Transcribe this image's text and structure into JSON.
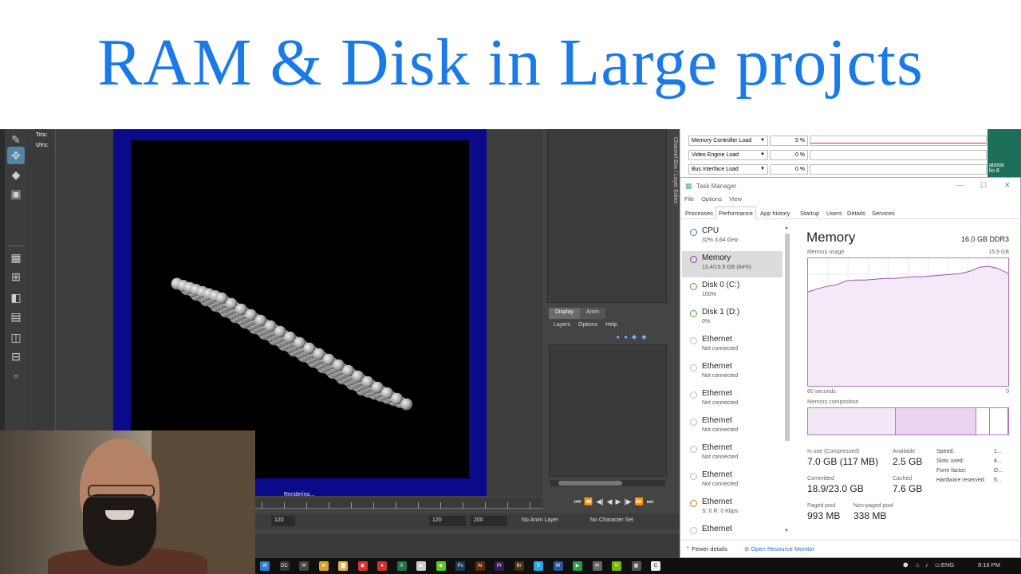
{
  "banner": {
    "title": "RAM & Disk in Large projcts"
  },
  "maya": {
    "hud": {
      "tris": "Tris:",
      "uvs": "UVs:"
    },
    "render_status": "Rendering...",
    "side_panel_label": "Channel Box / Layer Editor",
    "layer_tabs": [
      "Display",
      "Anim"
    ],
    "layer_menu": [
      "Layers",
      "Options",
      "Help"
    ],
    "range": {
      "end1": "120",
      "end2": "120",
      "end3": "200",
      "anim_layer": "No Anim Layer",
      "char_set": "No Character Set"
    }
  },
  "perfmon": {
    "rows": [
      {
        "name": "Memory Controller Load",
        "value": "5 %"
      },
      {
        "name": "Video Engine Load",
        "value": "0 %"
      },
      {
        "name": "Bus Interface Load",
        "value": "0 %"
      }
    ],
    "desktop_icon_label": "atasia\nlio 8"
  },
  "taskmanager": {
    "title": "Task Manager",
    "menu": [
      "File",
      "Options",
      "View"
    ],
    "tabs": [
      "Processes",
      "Performance",
      "App history",
      "Startup",
      "Users",
      "Details",
      "Services"
    ],
    "active_tab": "Performance",
    "devices": [
      {
        "name": "CPU",
        "sub": "32% 3.64 GHz",
        "color": "#2a7fc9"
      },
      {
        "name": "Memory",
        "sub": "13.4/15.9 GB (84%)",
        "color": "#8b3fa8",
        "selected": true
      },
      {
        "name": "Disk 0 (C:)",
        "sub": "100%",
        "color": "#4caa2c"
      },
      {
        "name": "Disk 1 (D:)",
        "sub": "0%",
        "color": "#4caa2c"
      },
      {
        "name": "Ethernet",
        "sub": "Not connected",
        "color": "#bbbbbb"
      },
      {
        "name": "Ethernet",
        "sub": "Not connected",
        "color": "#bbbbbb"
      },
      {
        "name": "Ethernet",
        "sub": "Not connected",
        "color": "#bbbbbb"
      },
      {
        "name": "Ethernet",
        "sub": "Not connected",
        "color": "#bbbbbb"
      },
      {
        "name": "Ethernet",
        "sub": "Not connected",
        "color": "#bbbbbb"
      },
      {
        "name": "Ethernet",
        "sub": "Not connected",
        "color": "#bbbbbb"
      },
      {
        "name": "Ethernet",
        "sub": "S: 0 R: 0 Kbps",
        "color": "#c97a2a"
      },
      {
        "name": "Ethernet",
        "sub": "",
        "color": "#bbbbbb"
      }
    ],
    "memory": {
      "title": "Memory",
      "capacity": "16.0 GB DDR3",
      "usage_label": "Memory usage",
      "usage_max": "15.9 GB",
      "axis_left": "60 seconds",
      "axis_right": "0",
      "composition_label": "Memory composition",
      "usage_history_gb": [
        11.7,
        12.1,
        12.4,
        12.6,
        13.1,
        13.2,
        13.2,
        13.3,
        13.4,
        13.4,
        13.5,
        13.6,
        13.6,
        13.7,
        13.8,
        13.9,
        14.0,
        14.3,
        14.8,
        14.9,
        14.6,
        14.0
      ],
      "composition_fractions": {
        "in_use": 0.44,
        "modified": 0.4,
        "standby": 0.07,
        "free": 0.09
      },
      "in_use_label": "In use (Compressed)",
      "in_use_value": "7.0 GB (117 MB)",
      "available_label": "Available",
      "available_value": "2.5 GB",
      "committed_label": "Committed",
      "committed_value": "18.9/23.0 GB",
      "cached_label": "Cached",
      "cached_value": "7.6 GB",
      "paged_label": "Paged pool",
      "paged_value": "993 MB",
      "nonpaged_label": "Non-paged pool",
      "nonpaged_value": "338 MB",
      "kv": [
        {
          "k": "Speed:",
          "v": "1..."
        },
        {
          "k": "Slots used:",
          "v": "4..."
        },
        {
          "k": "Form factor:",
          "v": "D..."
        },
        {
          "k": "Hardware reserved:",
          "v": "5..."
        }
      ]
    },
    "footer": {
      "fewer": "Fewer details",
      "resmon": "Open Resource Monitor"
    }
  },
  "taskbar": {
    "lang": "ENG",
    "time": "8:16 PM"
  }
}
